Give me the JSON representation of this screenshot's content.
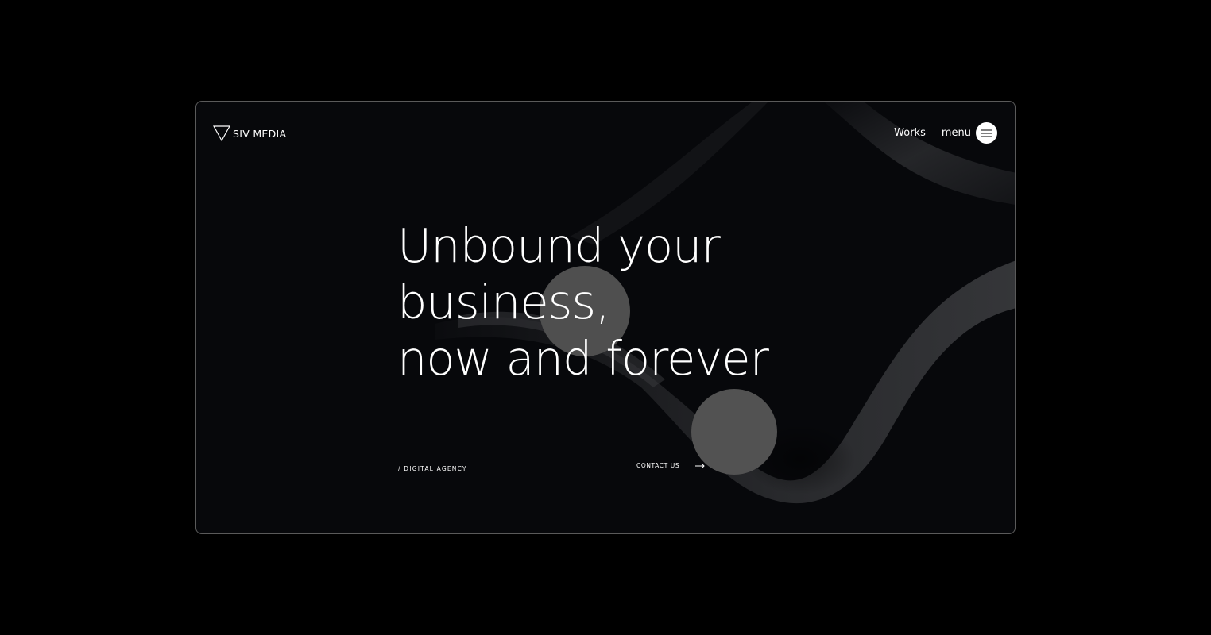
{
  "brand": {
    "name": "SIV MEDIA",
    "logo_icon": "triangle-outline-icon"
  },
  "nav": {
    "works_label": "Works",
    "menu_label": "menu",
    "menu_icon": "hamburger-icon"
  },
  "hero": {
    "headline_lines": [
      "Unbound your",
      "business,",
      "now and forever"
    ],
    "tagline": "/ DIGITAL AGENCY",
    "cta_label": "CONTACT US",
    "cta_icon": "arrow-right-icon"
  },
  "colors": {
    "page_background": "#000000",
    "frame_background": "#07080b",
    "frame_border": "#5a5a5a",
    "text": "#ffffff",
    "sphere": "#4f4f4f"
  }
}
